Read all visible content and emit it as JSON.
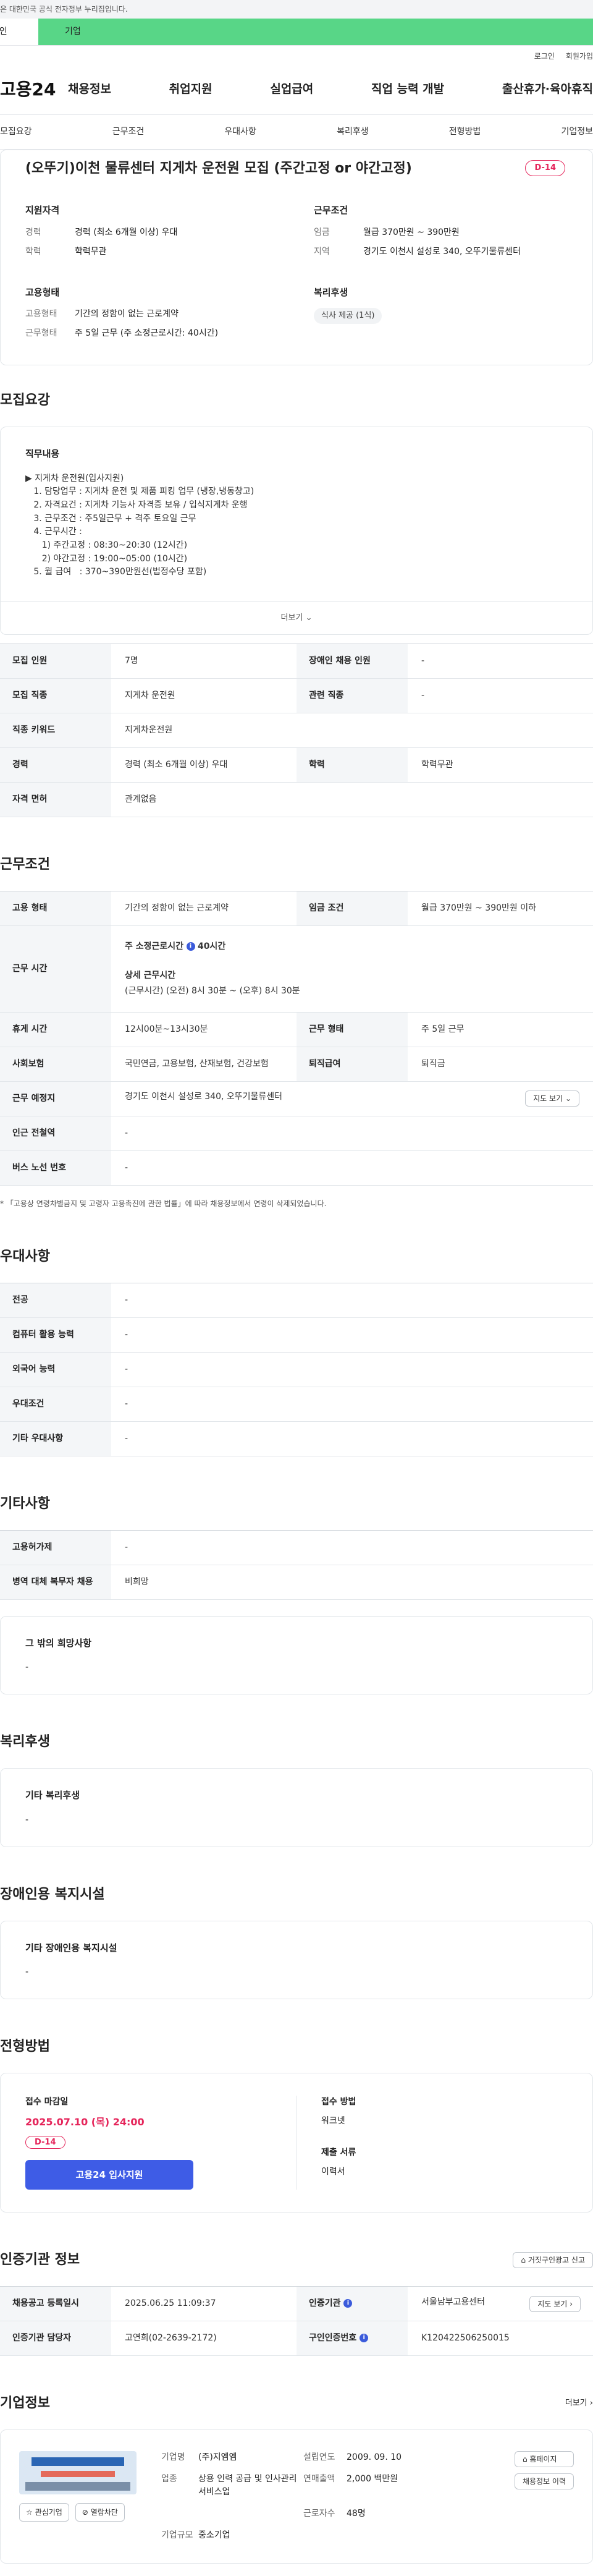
{
  "gov_banner": "이 누리집은 대한민국 공식 전자정부 누리집입니다.",
  "user_tabs": {
    "personal": "개인",
    "business": "기업"
  },
  "util": {
    "login": "로그인",
    "signup": "회원가입"
  },
  "logo": "고용24",
  "gnb": [
    "채용정보",
    "취업지원",
    "실업급여",
    "직업 능력 개발",
    "출산휴가·육아휴직"
  ],
  "anchor_tabs": [
    "모집요강",
    "근무조건",
    "우대사항",
    "복리후생",
    "전형방법",
    "기업정보"
  ],
  "job": {
    "title": "(오뚜기)이천 물류센터 지게차 운전원 모집 (주간고정 or 야간고정)",
    "dday": "D-14"
  },
  "summary": {
    "qual_title": "지원자격",
    "qual": [
      {
        "k": "경력",
        "v": "경력 (최소 6개월 이상) 우대"
      },
      {
        "k": "학력",
        "v": "학력무관"
      }
    ],
    "cond_title": "근무조건",
    "cond": [
      {
        "k": "임금",
        "v": "월급 370만원 ~ 390만원"
      },
      {
        "k": "지역",
        "v": "경기도 이천시 설성로 340, 오뚜기물류센터"
      }
    ],
    "emp_title": "고용형태",
    "emp": [
      {
        "k": "고용형태",
        "v": "기간의 정함이 없는 근로계약"
      },
      {
        "k": "근무형태",
        "v": "주 5일 근무 (주 소정근로시간: 40시간)"
      }
    ],
    "welfare_title": "복리후생",
    "welfare_chip": "식사 제공 (1식)"
  },
  "recruit": {
    "section_title": "모집요강",
    "duty_title": "직무내용",
    "duty_lines": [
      "▶ 지게차 운전원(입사지원)",
      "   1. 담당업무 : 지게차 운전 및 제품 피킹 업무 (냉장,냉동창고)",
      "   2. 자격요건 : 지게차 기능사 자격증 보유 / 입식지게차 운행",
      "   3. 근무조건 : 주5일근무 + 격주 토요일 근무",
      "   4. 근무시간 :",
      "      1) 주간고정 : 08:30~20:30 (12시간)",
      "      2) 야간고정 : 19:00~05:00 (10시간)",
      "   5. 월 급여   : 370~390만원선(법정수당 포함)"
    ],
    "more": "더보기",
    "rows": [
      [
        {
          "k": "모집 인원",
          "v": "7명"
        },
        {
          "k": "장애인 채용 인원",
          "v": "-"
        }
      ],
      [
        {
          "k": "모집 직종",
          "v": "지게차 운전원"
        },
        {
          "k": "관련 직종",
          "v": "-"
        }
      ],
      [
        {
          "k": "직종 키워드",
          "v": "지게차운전원"
        }
      ],
      [
        {
          "k": "경력",
          "v": "경력 (최소 6개월 이상) 우대"
        },
        {
          "k": "학력",
          "v": "학력무관"
        }
      ],
      [
        {
          "k": "자격 면허",
          "v": "관계없음"
        }
      ]
    ]
  },
  "work": {
    "section_title": "근무조건",
    "emp_type_k": "고용 형태",
    "emp_type_v": "기간의 정함이 없는 근로계약",
    "wage_k": "임금 조건",
    "wage_v": "월급 370만원 ~ 390만원 이하",
    "hours_k": "근무 시간",
    "hours_main": "주 소정근로시간",
    "hours_main_v": "40시간",
    "hours_detail_title": "상세 근무시간",
    "hours_detail": "(근무시간) (오전) 8시 30분 ~ (오후) 8시 30분",
    "rest_k": "휴게 시간",
    "rest_v": "12시00분~13시30분",
    "form_k": "근무 형태",
    "form_v": "주 5일 근무",
    "insurance_k": "사회보험",
    "insurance_v": "국민연금, 고용보험, 산재보험, 건강보험",
    "severance_k": "퇴직급여",
    "severance_v": "퇴직금",
    "place_k": "근무 예정지",
    "place_v": "경기도 이천시 설성로 340, 오뚜기물류센터",
    "map_btn": "지도 보기",
    "station_k": "인근 전철역",
    "station_v": "-",
    "bus_k": "버스 노선 번호",
    "bus_v": "-",
    "note": "* 「고용상 연령차별금지 및 고령자 고용촉진에 관한 법률」에 따라 채용정보에서 연령이 삭제되었습니다."
  },
  "pref": {
    "section_title": "우대사항",
    "rows": [
      {
        "k": "전공",
        "v": "-"
      },
      {
        "k": "컴퓨터 활용 능력",
        "v": "-"
      },
      {
        "k": "외국어 능력",
        "v": "-"
      },
      {
        "k": "우대조건",
        "v": "-"
      },
      {
        "k": "기타 우대사항",
        "v": "-"
      }
    ]
  },
  "etc": {
    "section_title": "기타사항",
    "rows": [
      {
        "k": "고용허가제",
        "v": "-"
      },
      {
        "k": "병역 대체 복무자 채용",
        "v": "비희망"
      }
    ],
    "hope_title": "그 밖의 희망사항",
    "hope_v": "-"
  },
  "welfare": {
    "section_title": "복리후생",
    "card_title": "기타 복리후생",
    "card_v": "-"
  },
  "disability": {
    "section_title": "장애인용 복지시설",
    "card_title": "기타 장애인용 복지시설",
    "card_v": "-"
  },
  "apply": {
    "section_title": "전형방법",
    "deadline_title": "접수 마감일",
    "deadline": "2025.07.10 (목) 24:00",
    "dday": "D-14",
    "apply_btn": "고용24 입사지원",
    "method_title": "접수 방법",
    "method_v": "워크넷",
    "docs_title": "제출 서류",
    "docs_v": "이력서"
  },
  "agency": {
    "section_title": "인증기관 정보",
    "report_btn": "거짓구인광고 신고",
    "reg_k": "채용공고 등록일시",
    "reg_v": "2025.06.25 11:09:37",
    "org_k": "인증기관",
    "org_v": "서울남부고용센터",
    "map_btn": "지도 보기",
    "manager_k": "인증기관 담당자",
    "manager_v": "고연희(02-2639-2172)",
    "id_k": "구인인증번호",
    "id_v": "K120422506250015"
  },
  "company": {
    "section_title": "기업정보",
    "more": "더보기",
    "fav_btn": "관심기업",
    "block_btn": "열람차단",
    "info": [
      {
        "k": "기업명",
        "v": "(주)지엠엠"
      },
      {
        "k": "설립연도",
        "v": "2009. 09. 10"
      },
      {
        "k": "업종",
        "v": "상용 인력 공급 및 인사관리 서비스업"
      },
      {
        "k": "연매출액",
        "v": "2,000 백만원"
      },
      {
        "k": "",
        "v": ""
      },
      {
        "k": "근로자수",
        "v": "48명"
      },
      {
        "k": "기업규모",
        "v": "중소기업"
      }
    ],
    "homepage_btn": "홈페이지",
    "other_jobs_btn": "채용정보 이력"
  }
}
